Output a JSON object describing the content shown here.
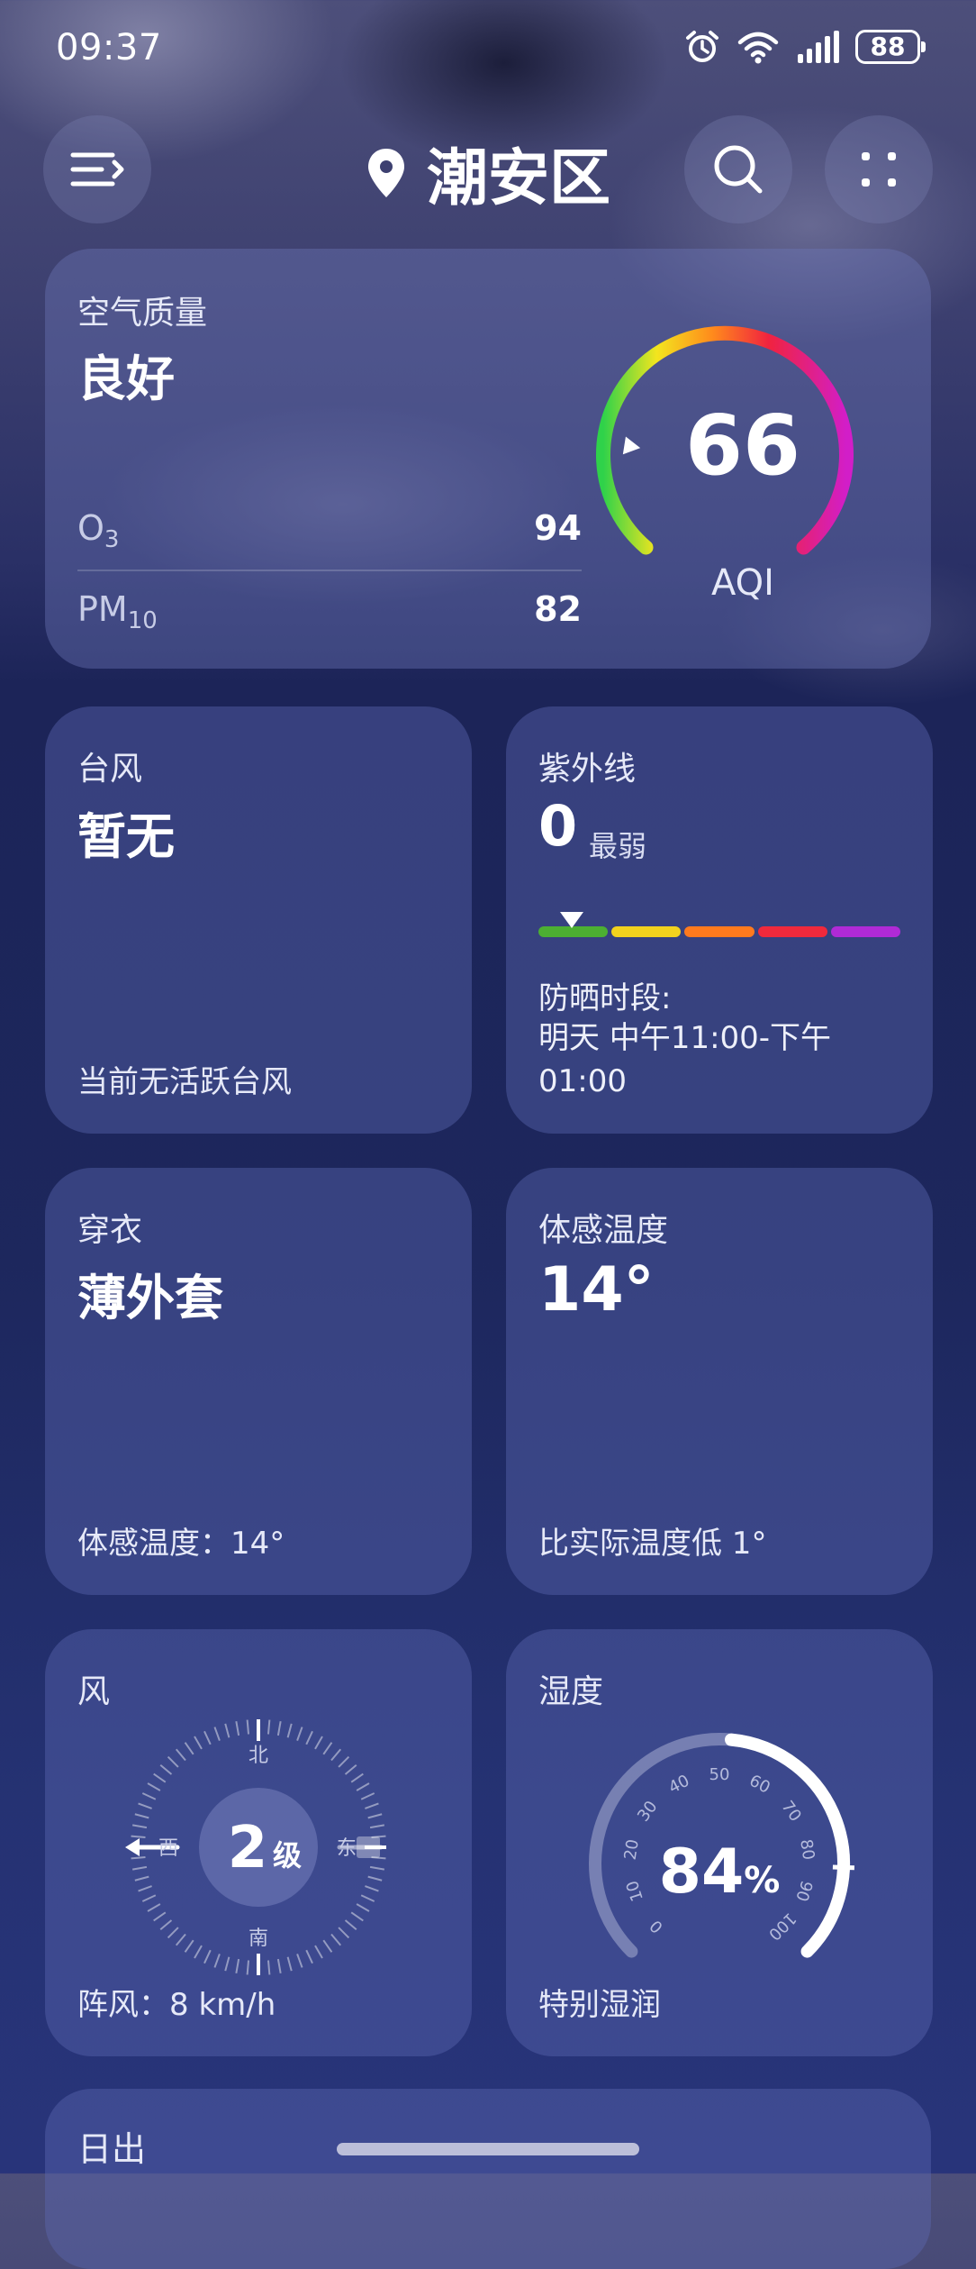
{
  "status_bar": {
    "time": "09:37",
    "battery": "88",
    "icons": [
      "alarm-icon",
      "wifi-icon",
      "signal-icon",
      "battery-icon"
    ]
  },
  "header": {
    "location": "潮安区",
    "icons": [
      "menu-icon",
      "location-pin-icon",
      "search-icon",
      "more-icon"
    ]
  },
  "air_quality": {
    "label": "空气质量",
    "status": "良好",
    "aqi_value": "66",
    "aqi_label": "AQI",
    "aqi_level": 0.2,
    "pollutants": [
      {
        "name": "O",
        "sub": "3",
        "value": "94"
      },
      {
        "name": "PM",
        "sub": "10",
        "value": "82"
      }
    ]
  },
  "typhoon": {
    "label": "台风",
    "status": "暂无",
    "footer": "当前无活跃台风"
  },
  "uv": {
    "label": "紫外线",
    "value": "0",
    "level": "最弱",
    "sunscreen_label": "防晒时段:",
    "sunscreen_time": "明天 中午11:00-下午01:00",
    "scale_colors": [
      "#4caf32",
      "#f2d21e",
      "#ff7a1e",
      "#f0293c",
      "#b02ad6"
    ]
  },
  "clothing": {
    "label": "穿衣",
    "advice": "薄外套",
    "footer": "体感温度：14°"
  },
  "feels_like": {
    "label": "体感温度",
    "value": "14°",
    "footer": "比实际温度低 1°"
  },
  "wind": {
    "label": "风",
    "level_number": "2",
    "level_unit": "级",
    "directions": {
      "north": "北",
      "south": "南",
      "west": "西",
      "east": "东"
    },
    "gust": "阵风：8 km/h",
    "icons": [
      "wind-arrow-icon"
    ]
  },
  "humidity": {
    "label": "湿度",
    "value": "84",
    "unit": "%",
    "level": 0.84,
    "ticks": [
      "0",
      "10",
      "20",
      "30",
      "40",
      "50",
      "60",
      "70",
      "80",
      "90",
      "100"
    ],
    "description": "特别湿润"
  },
  "sunrise": {
    "label": "日出"
  }
}
